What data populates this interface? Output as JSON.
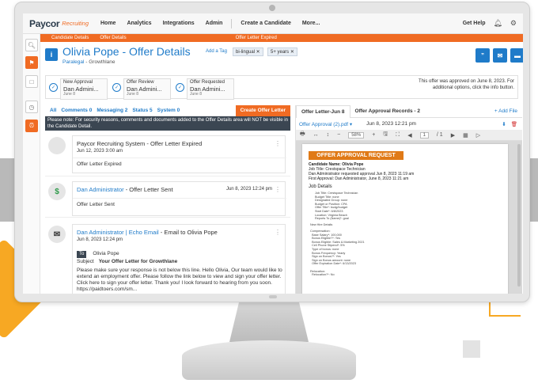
{
  "nav": {
    "logo": "Paycor",
    "logo_sub": "Recruiting",
    "items": [
      "Home",
      "Analytics",
      "Integrations",
      "Admin",
      "Create a Candidate",
      "More..."
    ],
    "help": "Get Help"
  },
  "subnav": {
    "candidate_details": "Candidate Details",
    "offer_details": "Offer Details",
    "offer_status": "Offer Letter Expired"
  },
  "candidate": {
    "name": "Olivia Pope - Offer Details",
    "role": "Paralegal",
    "company": " - Growthlane",
    "add_tag": "Add a Tag",
    "tags": [
      "bi-lingual ✕",
      "5+ years ✕"
    ],
    "info_icon": "i"
  },
  "workflow": {
    "steps": [
      {
        "title": "New Approval",
        "who": "Dan Admini...",
        "date": "June 8"
      },
      {
        "title": "Offer Review",
        "who": "Dan Admini...",
        "date": "June 8"
      },
      {
        "title": "Offer Requested",
        "who": "Dan Admini...",
        "date": "June 8"
      }
    ],
    "note": "This offer was approved on June 8, 2023. For additional options, click the info button."
  },
  "feed": {
    "tabs": [
      "All",
      "Comments 0",
      "Messaging 2",
      "Status 5",
      "System 0"
    ],
    "create_button": "Create Offer Letter",
    "notice": "Please note: For security reasons, comments and documents added to the Offer Details area will NOT be visible in the Candidate Detail.",
    "items": [
      {
        "avatar": "",
        "title": "Paycor Recruiting System - Offer Letter Expired",
        "date": "Jun 12, 2023 3:00 am",
        "body": "Offer Letter Expired"
      },
      {
        "avatar": "$",
        "who": "Dan Administrator",
        "title": " - Offer Letter Sent",
        "right_date": "Jun 8, 2023 12:24 pm",
        "body": "Offer Letter Sent"
      },
      {
        "avatar": "✉",
        "who": "Dan Administrator | Echo Email",
        "title": " - Email to Olivia Pope",
        "date": "Jun 8, 2023 12:24 pm",
        "to_label": "To",
        "to_value": "Olivia Pope",
        "subject_label": "Subject",
        "subject_value": "Your Offer Letter for Growthlane",
        "body": "Please make sure your response is not below this line. Hello Olivia, Our team would like to extend an employment offer. Please follow the link below to view and sign your offer letter. Click here to sign your offer letter. Thank you! I look forward to hearing from you soon. https://paidtoers.com/sm..."
      }
    ]
  },
  "docs": {
    "tabs": [
      "Offer Letter-Jun 8",
      "Offer Approval Records - 2"
    ],
    "add_file": "+ Add File",
    "file_name": "Offer Approval (2).pdf ▾",
    "file_date": "Jun 8, 2023 12:21 pm",
    "zoom": "58%",
    "page": "1",
    "page_total": "/ 1",
    "pdf": {
      "heading": "OFFER APPROVAL REQUEST",
      "line1": "Candidate Name: Olivia Pope",
      "line2": "Job Title: Crestspace Technician",
      "line3": "Dan Administrator requested approval Jun 8, 2023 11:19 am",
      "line4": "First Approval: Dan Administrator, June 8, 2023 11:21 am",
      "section": "Job Details",
      "details": "Job Title: Crestspace Technician\nBudget Title: none\nDesignated Group: none\nBudget or Position: CPA\nOffer Title*: budg/budget\nStart Date*: 6/8/2023\nLocation: Virginia Beach\nReports To (Name)*: goal",
      "section2": "New Hire Details",
      "details2": "Compensation:\n  Base Salary*: 100,000\n  Bonus Eligible?*: Yes\n  Bonus Eligible: Sales & Marketing 2021\n  Cell Phone Stipend*: 5%\n  Type of bonus: none\n  Bonus Frequency: Yearly\n  Sign on Bonus?*: Yes\n  Sign on Bonus amount: none\n  Offer Expiration Date*: 6/13/2023\n\nRelocation:\n  Relocation?*: No"
    }
  }
}
